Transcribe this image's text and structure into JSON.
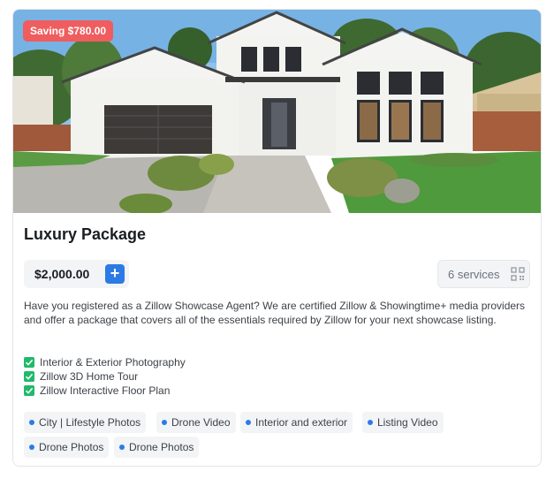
{
  "package": {
    "saving_badge": "Saving $780.00",
    "title": "Luxury Package",
    "price": "$2,000.00",
    "add_button_label": "+",
    "services_count": "6 services",
    "services_icon": "qr-code-icon",
    "description": "Have you registered as a Zillow Showcase Agent? We are certified Zillow & Showingtime+ media providers and offer a package that covers all of the essentials required by Zillow for your next showcase listing.",
    "features": [
      "Interior & Exterior Photography",
      "Zillow 3D Home Tour",
      "Zillow Interactive Floor Plan"
    ],
    "tags": [
      "City | Lifestyle Photos",
      "Drone Video",
      "Interior and exterior",
      "Listing Video",
      "Drone Photos",
      "Drone Photos"
    ]
  },
  "colors": {
    "badge_bg": "#f05d5e",
    "accent_blue": "#2c7be5",
    "check_green": "#21b96a",
    "pill_bg": "#f3f4f6"
  }
}
